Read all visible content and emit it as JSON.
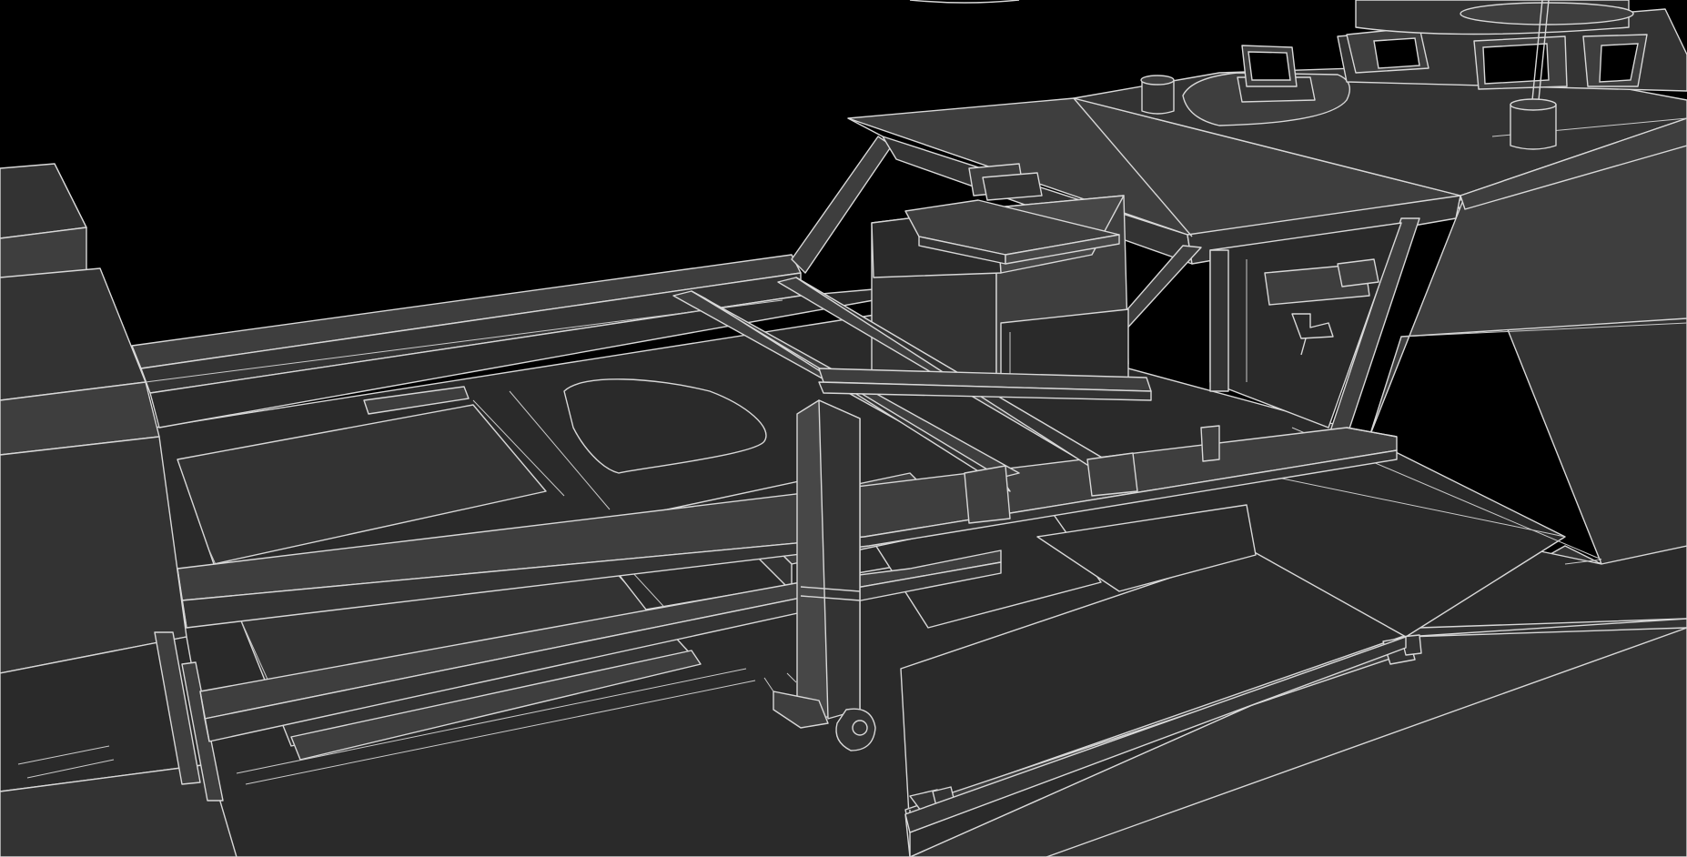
{
  "scene": {
    "kind": "3d-wireframe-render",
    "subject": "ship-deck-with-frame-and-superstructure",
    "colors": {
      "background": "#000000",
      "edge": "#d8d8d8",
      "surface_dark": "#2a2a2a",
      "surface_mid": "#333333",
      "surface_light": "#3e3e3e",
      "surface_lighter": "#474747"
    }
  }
}
